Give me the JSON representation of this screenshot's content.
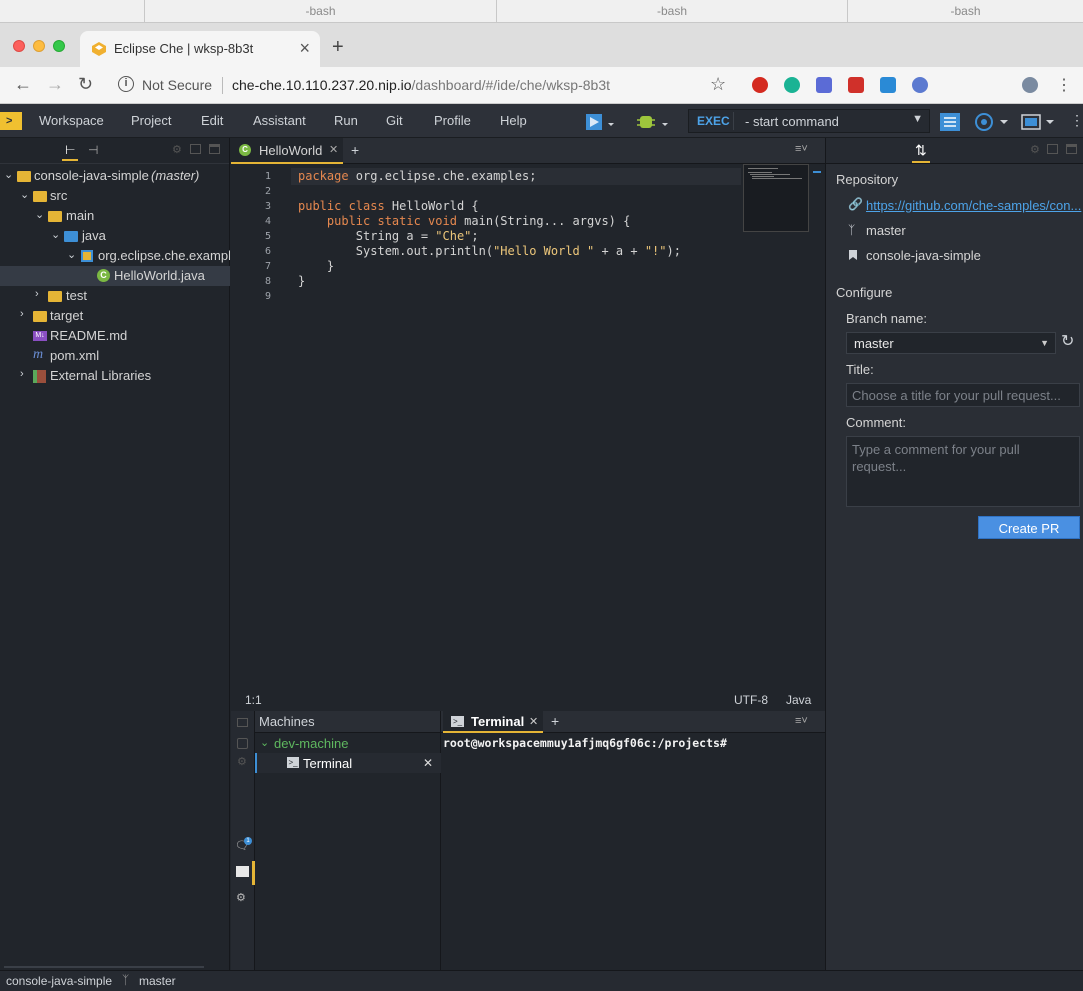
{
  "terminal_tabs": [
    "-bash",
    "-bash",
    "-bash"
  ],
  "browser": {
    "tab_title": "Eclipse Che | wksp-8b3t",
    "tab_close": "×",
    "new_tab": "+",
    "not_secure": "Not Secure",
    "url_host": "che-che.10.110.237.20.nip.io",
    "url_path": "/dashboard/#/ide/che/wksp-8b3t"
  },
  "menubar": {
    "items": [
      "Workspace",
      "Project",
      "Edit",
      "Assistant",
      "Run",
      "Git",
      "Profile",
      "Help"
    ],
    "exec_label": "EXEC",
    "command": "- start command"
  },
  "project": {
    "root_name": "console-java-simple",
    "root_branch": "(master)",
    "tree": [
      "src",
      "main",
      "java",
      "org.eclipse.che.examples",
      "HelloWorld.java",
      "test",
      "target",
      "README.md",
      "pom.xml",
      "External Libraries"
    ]
  },
  "editor": {
    "tab_label": "HelloWorld",
    "line_numbers": [
      "1",
      "2",
      "3",
      "4",
      "5",
      "6",
      "7",
      "8",
      "9"
    ],
    "status_position": "1:1",
    "status_encoding": "UTF-8",
    "status_language": "Java"
  },
  "machines": {
    "header": "Machines",
    "machine": "dev-machine",
    "terminal": "Terminal"
  },
  "terminal": {
    "tab_label": "Terminal",
    "prompt": "root@workspacemmuy1afjmq6gf06c:/projects#"
  },
  "git": {
    "repository_heading": "Repository",
    "repo_url": "https://github.com/che-samples/con...",
    "branch": "master",
    "project": "console-java-simple",
    "configure_heading": "Configure",
    "branch_name_label": "Branch name:",
    "branch_value": "master",
    "title_label": "Title:",
    "title_placeholder": "Choose a title for your pull request...",
    "comment_label": "Comment:",
    "comment_placeholder": "Type a comment for your pull request...",
    "create_button": "Create PR"
  },
  "status": {
    "project": "console-java-simple",
    "branch": "master"
  },
  "colors": {
    "accent": "#e5b536",
    "link": "#4da3e8",
    "button": "#4a90e2"
  }
}
